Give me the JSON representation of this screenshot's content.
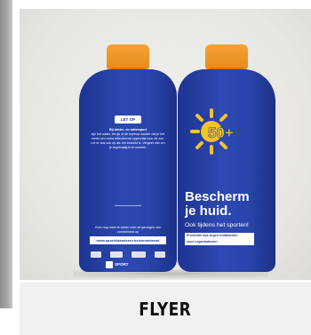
{
  "caption": "FLYER",
  "product_image": {
    "description_icon": "sunscreen-bottle-flyer",
    "left_bottle": {
      "tag": "LET OP",
      "lead": "Bij winter- en watersport",
      "body_text": "zijn het water, het ijs of de sneeuw zonder dat je het merkt een extra reflecterend oppervlak voor de zon. Let er dus ook op als het bewolkt is. Vergeet niet om je regelmatig in te smeren.",
      "footer_text": "Kom nog meer te weten over de gevolgen van zonnebrand op",
      "url": "www.sportvlaanderen.be/zonnebrand",
      "sport_logo": "SPORT"
    },
    "right_bottle": {
      "sun_label": "50+",
      "headline_line1": "Bescherm",
      "headline_line2": "je huid.",
      "subline": "Ook tijdens het sporten!",
      "note_line1": "Preventie tips tegen huidkanker",
      "note_line2": "voor organisatoren"
    },
    "colors": {
      "bottle_blue": "#2a46ad",
      "cap_orange": "#f19a2a",
      "sun_yellow": "#f4c22b"
    }
  }
}
